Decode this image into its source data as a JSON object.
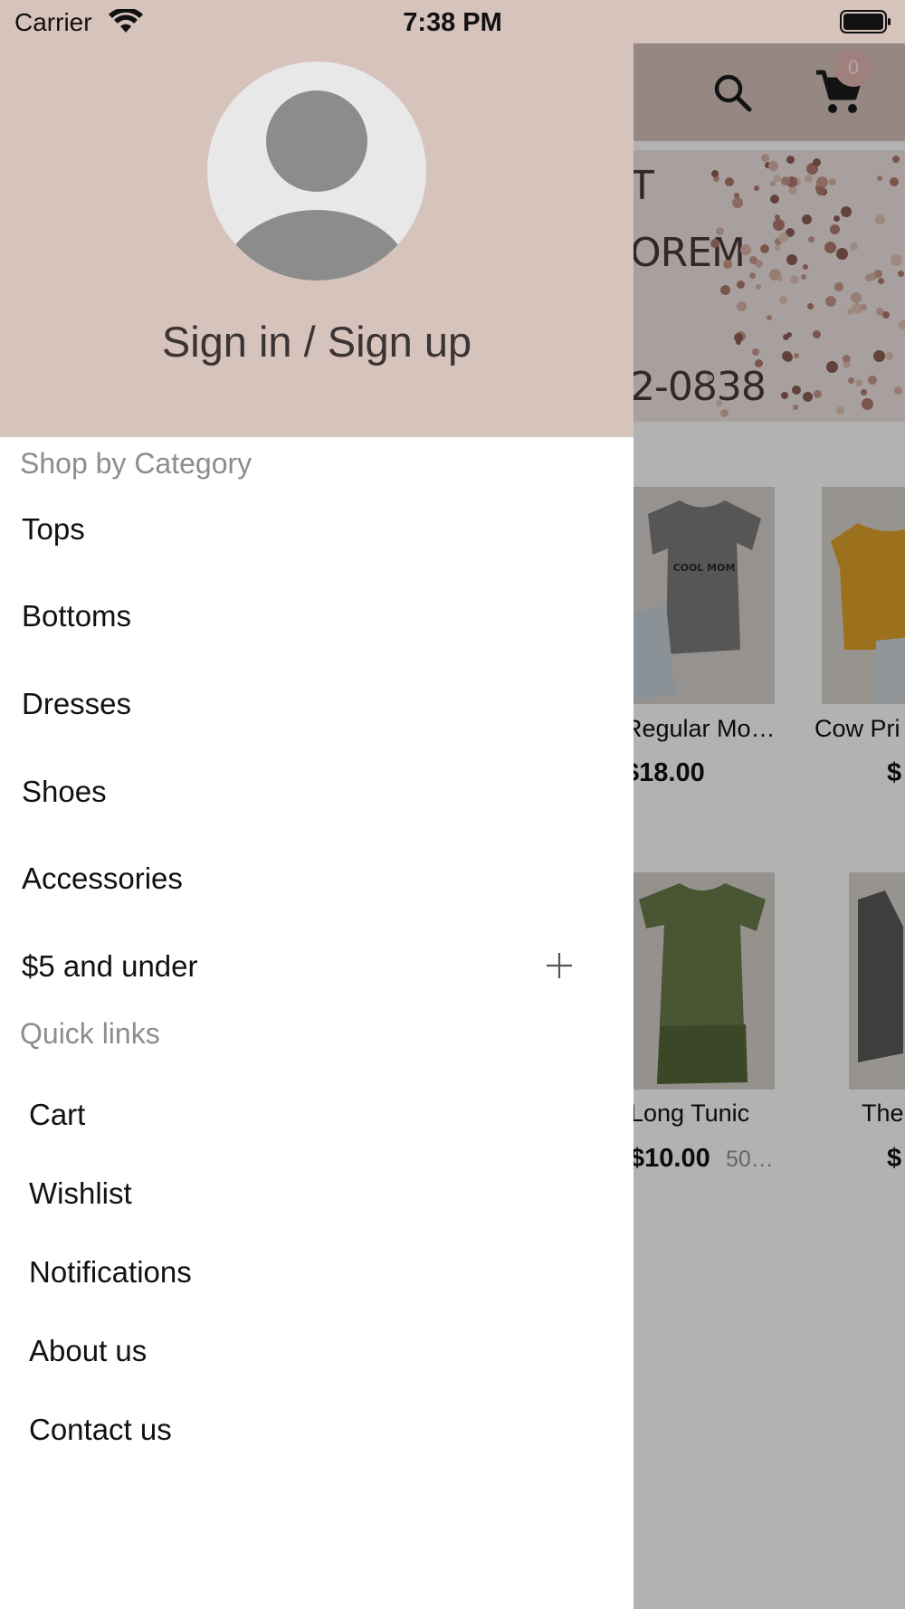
{
  "status_bar": {
    "carrier": "Carrier",
    "time": "7:38 PM"
  },
  "header": {
    "cart_count": "0",
    "search_icon": "search-icon",
    "cart_icon": "cart-icon"
  },
  "banner": {
    "line1": "T",
    "line2": "OREM",
    "line3": "2-0838"
  },
  "products": [
    {
      "name": "Regular Mo…",
      "price": "$18.00"
    },
    {
      "name": "Cow Pri",
      "price": "$"
    },
    {
      "name": "Long Tunic",
      "price": "$10.00",
      "sale": "50…"
    },
    {
      "name": "The",
      "price": "$"
    }
  ],
  "drawer": {
    "signin_label": "Sign in / Sign up",
    "categories_title": "Shop by Category",
    "categories": [
      {
        "label": "Tops"
      },
      {
        "label": "Bottoms"
      },
      {
        "label": "Dresses"
      },
      {
        "label": "Shoes"
      },
      {
        "label": "Accessories"
      },
      {
        "label": "$5 and under",
        "expandable": true
      }
    ],
    "quick_links_title": "Quick links",
    "quick_links": [
      {
        "label": "Cart"
      },
      {
        "label": "Wishlist"
      },
      {
        "label": "Notifications"
      },
      {
        "label": "About us"
      },
      {
        "label": "Contact us"
      }
    ]
  },
  "colors": {
    "header_bg": "#d6c3bc",
    "drawer_bg": "#ffffff",
    "section_title": "#8d8d8d",
    "overlay": "rgba(0,0,0,0.30)"
  }
}
